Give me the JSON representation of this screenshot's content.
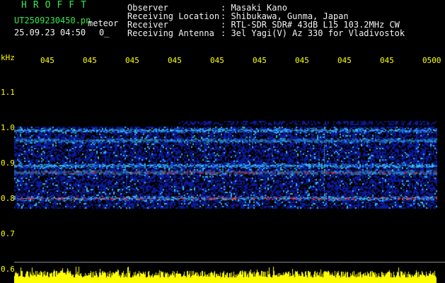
{
  "logo": "HROFFT",
  "file": {
    "name": "UT2509230450.pn",
    "tag": "meteor",
    "date": "25.09.23 04:50",
    "count": "0_"
  },
  "info": [
    {
      "label": "Observer",
      "value": ": Masaki Kano"
    },
    {
      "label": "Receiving Location",
      "value": ": Shibukawa, Gunma, Japan"
    },
    {
      "label": "Receiver",
      "value": ": RTL-SDR SDR# 43dB L15 103.2MHz CW"
    },
    {
      "label": "Receiving Antenna",
      "value": ": 3el Yagi(V) Az 330 for Vladivostok"
    }
  ],
  "chart_data": {
    "type": "heatmap",
    "ylabel": "kHz",
    "y_ticks": [
      "1.1",
      "1.0",
      "0.9",
      "0.8",
      "0.7",
      "0.6"
    ],
    "x_ticks": [
      "045",
      "045",
      "045",
      "045",
      "045",
      "045",
      "045",
      "045",
      "045",
      "0500"
    ],
    "ylim": [
      0.6,
      1.1
    ],
    "bands_khz": [
      0.802,
      0.875,
      0.894,
      0.965,
      0.994
    ],
    "colors": {
      "background": "#000000",
      "noise": "#0a1a9a",
      "band_mid": "#33bbee",
      "band_hot": "#ff2020",
      "amplitude": "#ffff00",
      "label_green": "#35e84a",
      "label_white": "#f2f2f2"
    }
  }
}
